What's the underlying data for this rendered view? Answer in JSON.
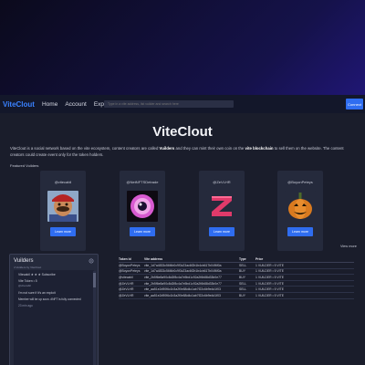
{
  "navbar": {
    "brand": "ViteClout",
    "links": [
      "Home",
      "Account",
      "Explorer"
    ],
    "search_placeholder": "Type in a vite address, list vuilder and search here",
    "connect_label": "Connect"
  },
  "hero": {
    "title": "ViteClout",
    "intro_part1": "ViteClout is a social network based on the vite ecosystem, content creators are called ",
    "intro_bold1": "Vuilders",
    "intro_part2": " and they can mint their own coin on the ",
    "intro_bold2": "vite blockchain",
    "intro_part3": " to sell them on the website. The content creators could create event only for the token holders."
  },
  "featured": {
    "label": "Featured Vuilders",
    "view_more": "View more",
    "cards": [
      {
        "name": "@vitecabil",
        "button": "Learn more",
        "avatar": "mario-avatar"
      },
      {
        "name": "@NetNFTSDetrade",
        "button": "Learn more",
        "avatar": "eye-avatar"
      },
      {
        "name": "@ZeVLHR",
        "button": "Learn more",
        "avatar": "z-logo-avatar"
      },
      {
        "name": "@BoyonPeteys",
        "button": "Learn more",
        "avatar": "pumpkin-avatar"
      }
    ]
  },
  "vuilders_panel": {
    "title": "Vuilders",
    "subtitle": "4 Vuilders by ViteClout",
    "post": {
      "header": "Vitecabil  ★ ★ ★  Subscribe",
      "token_line": "Vite Token • 5",
      "handle": "@vitecabil",
      "reply_line": "I'm not sure if it's an exploit",
      "note": "Member will be up soon. #NFT is fully connected",
      "footer": "23 min ago"
    }
  },
  "holders_table": {
    "headers": [
      "Token Id",
      "Vite address",
      "Type",
      "Price"
    ],
    "rows": [
      [
        "@BoyonPeteys",
        "vite_1d7a4833c56f4b0c9f3c23ac6f2b1b4cb617b04f6f0a",
        "SELL",
        "1 VUILDER • 5 VITE"
      ],
      [
        "@BoyonPeteys",
        "vite_1d7a4833c56f4b0c9f3c23ac6f2b1b4cb617b04f6f0a",
        "BUY",
        "1 VUILDER • 5 VITE"
      ],
      [
        "@vitecabil",
        "vite_2b5f6e8a90c8d2f8c4a7e5bd1c92a2f6b88d33b0e77",
        "BUY",
        "1 VUILDER • 5 VITE"
      ],
      [
        "@ZeVLHR",
        "vite_2b5f6e8a90c8d2f8c4a7e5bd1c92a2f6b88d33b0e77",
        "SELL",
        "1 VUILDER • 5 VITE"
      ],
      [
        "@ZeVLHR",
        "vite_aa51e2d90f6c1b3a2f0e88d4c1ab7f22c6b9e4d1f03",
        "SELL",
        "1 VUILDER • 5 VITE"
      ],
      [
        "@ZeVLHR",
        "vite_aa51e2d90f6c1b3a2f0e88d4c1ab7f22c6b9e4d1f03",
        "BUY",
        "1 VUILDER • 5 VITE"
      ]
    ]
  },
  "colors": {
    "accent": "#2f6df0",
    "brand": "#3a82ff",
    "panel_bg": "#252a3c",
    "page_bg": "#1a1d2b"
  }
}
